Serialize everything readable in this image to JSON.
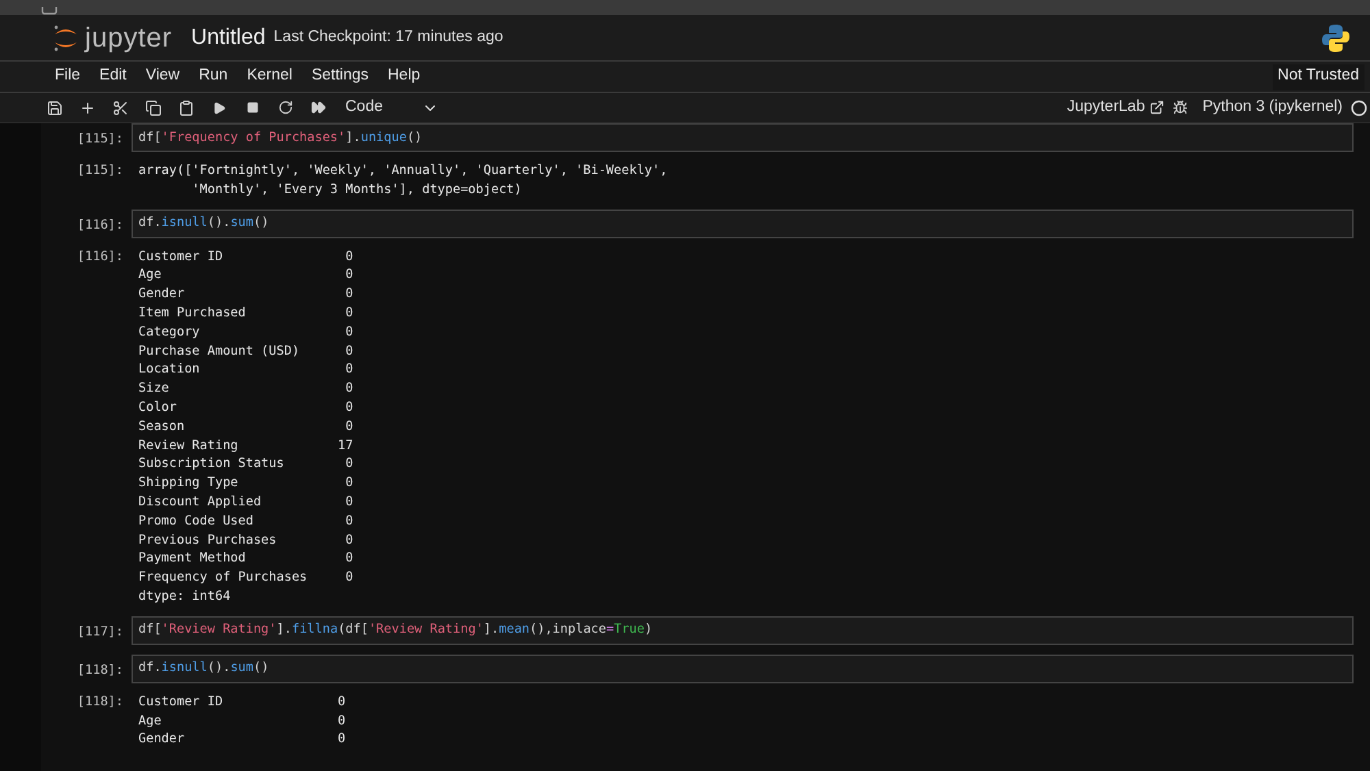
{
  "header": {
    "logo_text": "jupyter",
    "title": "Untitled",
    "checkpoint": "Last Checkpoint: 17 minutes ago"
  },
  "menu": [
    "File",
    "Edit",
    "View",
    "Run",
    "Kernel",
    "Settings",
    "Help"
  ],
  "trust": "Not Trusted",
  "toolbar": {
    "cell_type": "Code",
    "interface": "JupyterLab",
    "kernel": "Python 3 (ipykernel)",
    "kernel_busy": false
  },
  "cells": [
    {
      "kind": "code",
      "prompt": "[115]:",
      "tokens": [
        {
          "kind": "plain",
          "text": "df["
        },
        {
          "kind": "string",
          "text": "'Frequency of Purchases'"
        },
        {
          "kind": "plain",
          "text": "]."
        },
        {
          "kind": "func",
          "text": "unique"
        },
        {
          "kind": "plain",
          "text": "()"
        }
      ]
    },
    {
      "kind": "output",
      "prompt": "[115]:",
      "lines": [
        "array(['Fortnightly', 'Weekly', 'Annually', 'Quarterly', 'Bi-Weekly',",
        "       'Monthly', 'Every 3 Months'], dtype=object)"
      ]
    },
    {
      "kind": "code",
      "prompt": "[116]:",
      "tokens": [
        {
          "kind": "plain",
          "text": "df."
        },
        {
          "kind": "func",
          "text": "isnull"
        },
        {
          "kind": "plain",
          "text": "()."
        },
        {
          "kind": "func",
          "text": "sum"
        },
        {
          "kind": "plain",
          "text": "()"
        }
      ]
    },
    {
      "kind": "output",
      "prompt": "[116]:",
      "lines": [
        "Customer ID                0",
        "Age                        0",
        "Gender                     0",
        "Item Purchased             0",
        "Category                   0",
        "Purchase Amount (USD)      0",
        "Location                   0",
        "Size                       0",
        "Color                      0",
        "Season                     0",
        "Review Rating             17",
        "Subscription Status        0",
        "Shipping Type              0",
        "Discount Applied           0",
        "Promo Code Used            0",
        "Previous Purchases         0",
        "Payment Method             0",
        "Frequency of Purchases     0",
        "dtype: int64"
      ]
    },
    {
      "kind": "code",
      "prompt": "[117]:",
      "tokens": [
        {
          "kind": "plain",
          "text": "df["
        },
        {
          "kind": "string",
          "text": "'Review Rating'"
        },
        {
          "kind": "plain",
          "text": "]."
        },
        {
          "kind": "func",
          "text": "fillna"
        },
        {
          "kind": "plain",
          "text": "(df["
        },
        {
          "kind": "string",
          "text": "'Review Rating'"
        },
        {
          "kind": "plain",
          "text": "]."
        },
        {
          "kind": "func",
          "text": "mean"
        },
        {
          "kind": "plain",
          "text": "(),inplace"
        },
        {
          "kind": "operator",
          "text": "="
        },
        {
          "kind": "keyword",
          "text": "True"
        },
        {
          "kind": "plain",
          "text": ")"
        }
      ]
    },
    {
      "kind": "code",
      "prompt": "[118]:",
      "tokens": [
        {
          "kind": "plain",
          "text": "df."
        },
        {
          "kind": "func",
          "text": "isnull"
        },
        {
          "kind": "plain",
          "text": "()."
        },
        {
          "kind": "func",
          "text": "sum"
        },
        {
          "kind": "plain",
          "text": "()"
        }
      ]
    },
    {
      "kind": "output",
      "prompt": "[118]:",
      "lines": [
        "Customer ID               0",
        "Age                       0",
        "Gender                    0"
      ]
    }
  ]
}
